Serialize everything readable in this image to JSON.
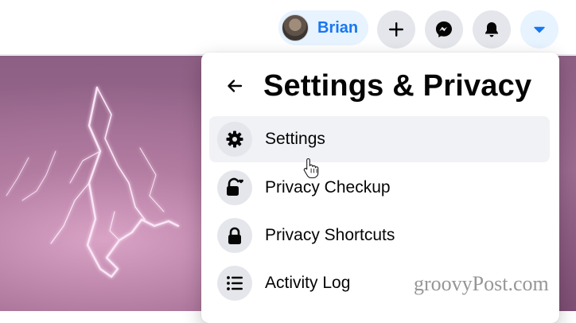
{
  "topbar": {
    "profile": {
      "name": "Brian"
    },
    "buttons": [
      {
        "icon": "plus-icon"
      },
      {
        "icon": "messenger-icon"
      },
      {
        "icon": "bell-icon"
      },
      {
        "icon": "caret-down-icon",
        "active": true
      }
    ],
    "colors": {
      "accent": "#1877f2",
      "chip_bg": "#e7f3ff",
      "button_bg": "#e4e6eb"
    }
  },
  "panel": {
    "title": "Settings & Privacy",
    "back_icon": "arrow-left-icon",
    "items": [
      {
        "label": "Settings",
        "icon": "gear-icon",
        "hovered": true
      },
      {
        "label": "Privacy Checkup",
        "icon": "lock-heart-icon"
      },
      {
        "label": "Privacy Shortcuts",
        "icon": "lock-icon"
      },
      {
        "label": "Activity Log",
        "icon": "list-icon"
      }
    ]
  },
  "watermark": "groovyPost.com"
}
